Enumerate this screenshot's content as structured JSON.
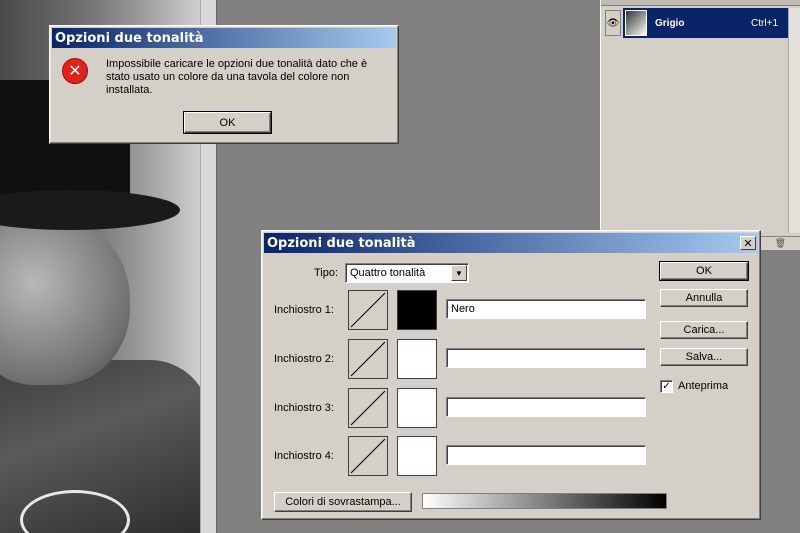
{
  "channels_panel": {
    "channel_name": "Grigio",
    "channel_shortcut": "Ctrl+1"
  },
  "error_dialog": {
    "title": "Opzioni due tonalità",
    "message": "Impossibile caricare le opzioni due tonalità dato che è stato usato un colore da una tavola del colore non installata.",
    "ok_label": "OK"
  },
  "duotone_dialog": {
    "title": "Opzioni due tonalità",
    "close_label": "✕",
    "type_label": "Tipo:",
    "type_value": "Quattro tonalità",
    "inks": [
      {
        "label": "Inchiostro 1:",
        "value": "Nero",
        "swatch_color": "#000000"
      },
      {
        "label": "Inchiostro 2:",
        "value": "",
        "swatch_color": "#ffffff"
      },
      {
        "label": "Inchiostro 3:",
        "value": "",
        "swatch_color": "#ffffff"
      },
      {
        "label": "Inchiostro 4:",
        "value": "",
        "swatch_color": "#ffffff"
      }
    ],
    "buttons": {
      "ok": "OK",
      "cancel": "Annulla",
      "load": "Carica...",
      "save": "Salva..."
    },
    "preview": {
      "label": "Anteprima",
      "checked": true
    },
    "overprint_label": "Colori di sovrastampa..."
  }
}
